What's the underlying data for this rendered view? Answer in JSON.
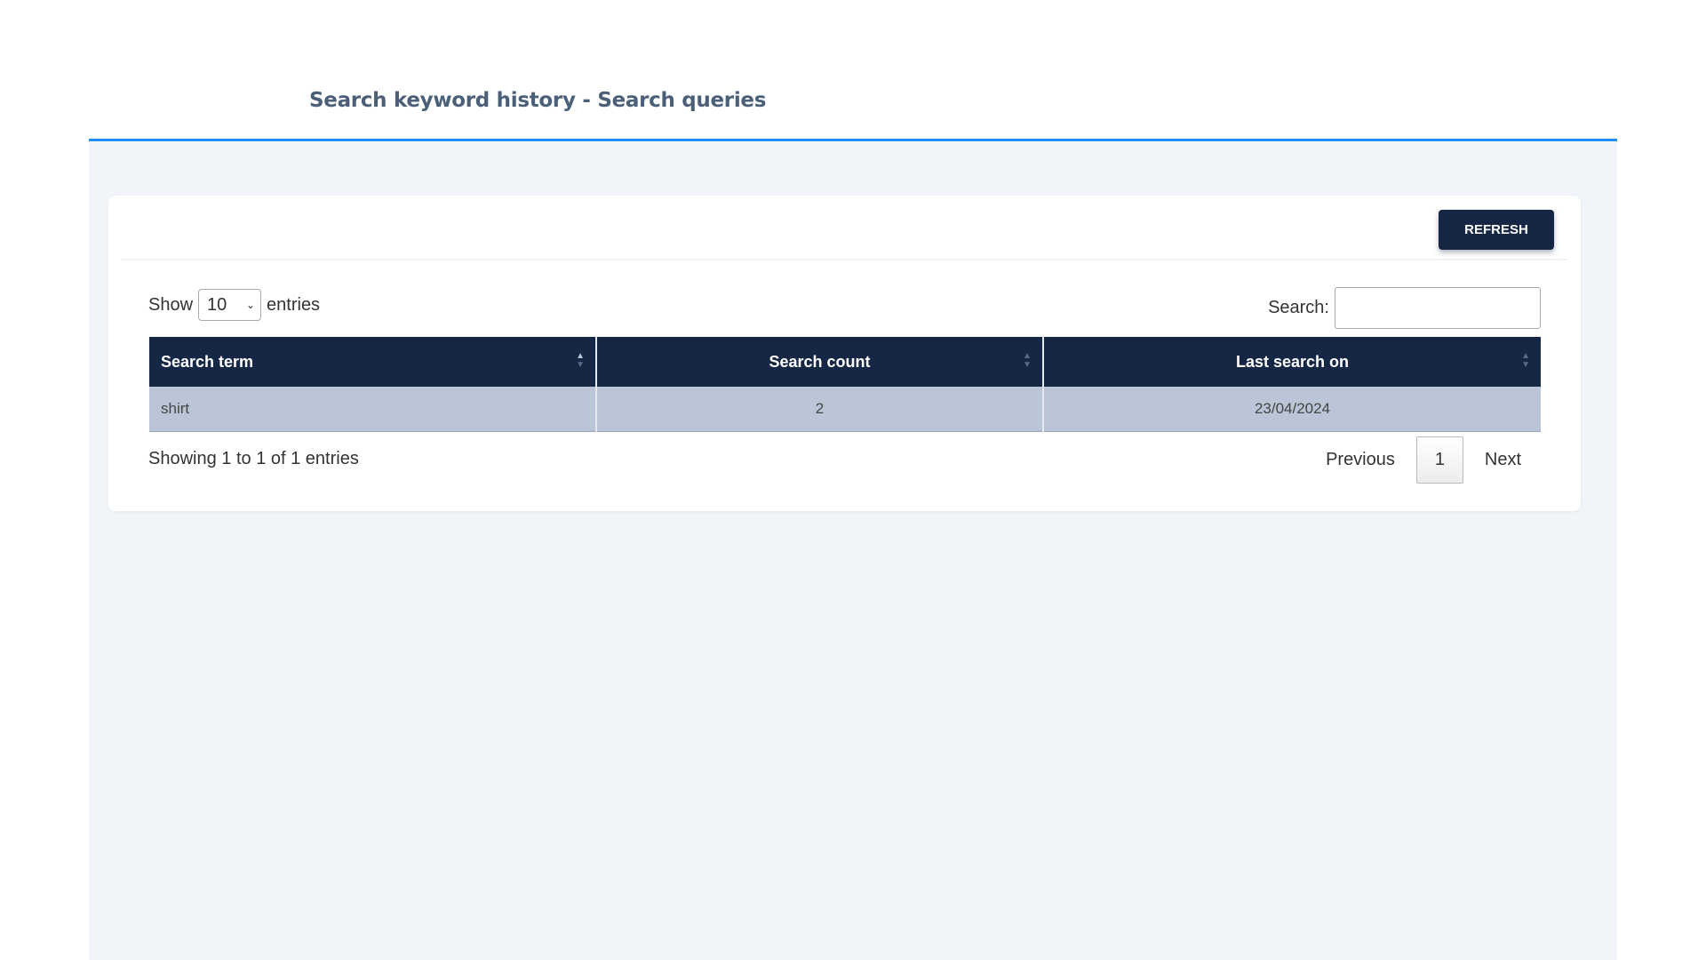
{
  "header": {
    "title": "Search keyword history - Search queries"
  },
  "toolbar": {
    "refresh_label": "REFRESH"
  },
  "length": {
    "show_label": "Show",
    "value": "10",
    "entries_label": "entries"
  },
  "search": {
    "label": "Search:",
    "value": ""
  },
  "table": {
    "columns": [
      "Search term",
      "Search count",
      "Last search on"
    ],
    "rows": [
      [
        "shirt",
        "2",
        "23/04/2024"
      ]
    ]
  },
  "footer": {
    "info": "Showing 1 to 1 of 1 entries",
    "previous": "Previous",
    "page": "1",
    "next": "Next"
  },
  "colors": {
    "accent": "#1f8ef1",
    "primary": "#152744",
    "row": "#bac6d7"
  }
}
